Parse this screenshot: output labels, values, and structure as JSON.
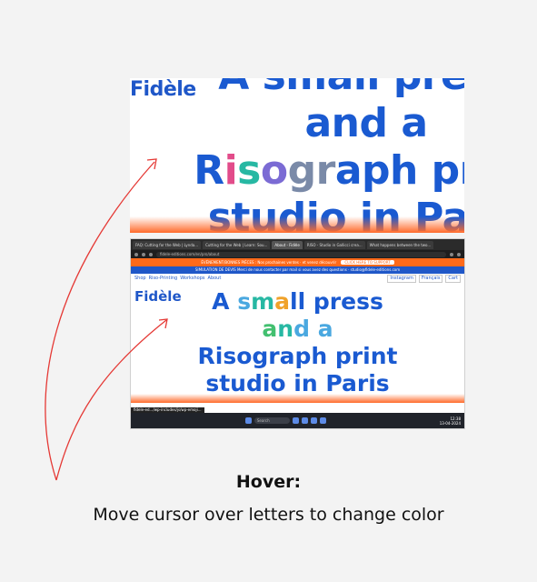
{
  "zoom_view": {
    "logo": "Fidèle",
    "headline": {
      "line1": "A small press",
      "line2": "and a",
      "line3_parts": [
        "R",
        "i",
        "s",
        "o",
        "g",
        "r",
        "a",
        "ph print"
      ],
      "line4": "studio in Paris"
    }
  },
  "browser": {
    "tabs": [
      "FAQ: Cutting for the Web | Lynda...",
      "Cutting for the Web | Learn: Sou...",
      "About - Fidèle",
      "RISO - Studio in Gallicci crea...",
      "What happens between the two..."
    ],
    "url": "fidele-editions.com/en/pro/about",
    "banner_orange": "ÉVÉNEMENT/BONNES PIÈCES : Nos prochaines ventes · et venez découvrir",
    "banner_orange_button": "CLICK HERE TO SUPPORT",
    "banner_blue": "SIMULATION DE DEVIS Merci de nous contacter par mail si vous avez des questions · studio@fidele-editions.com",
    "nav_left": [
      "Shop",
      "Riso-Printing",
      "Workshops",
      "About"
    ],
    "nav_right": [
      "Instagram",
      "Français",
      "Cart"
    ],
    "site_logo": "Fidèle",
    "site_headline": {
      "line1_parts": [
        "A ",
        "s",
        "m",
        "a",
        "ll press"
      ],
      "line2_parts": [
        "a",
        "n",
        "d a"
      ],
      "line3": "Risograph print",
      "line4": "studio in Paris"
    },
    "status_text": "fidele-ed.../wp-includes/js/wp-emoji...",
    "taskbar_search": "Search",
    "clock_time": "12:38",
    "clock_date": "13-04-2024"
  },
  "caption": {
    "title": "Hover:",
    "subtitle": "Move cursor over letters to change color"
  },
  "colors": {
    "brand_blue": "#1a5ad1",
    "accent_orange": "#ff6a1a",
    "arrow_red": "#e53935"
  }
}
